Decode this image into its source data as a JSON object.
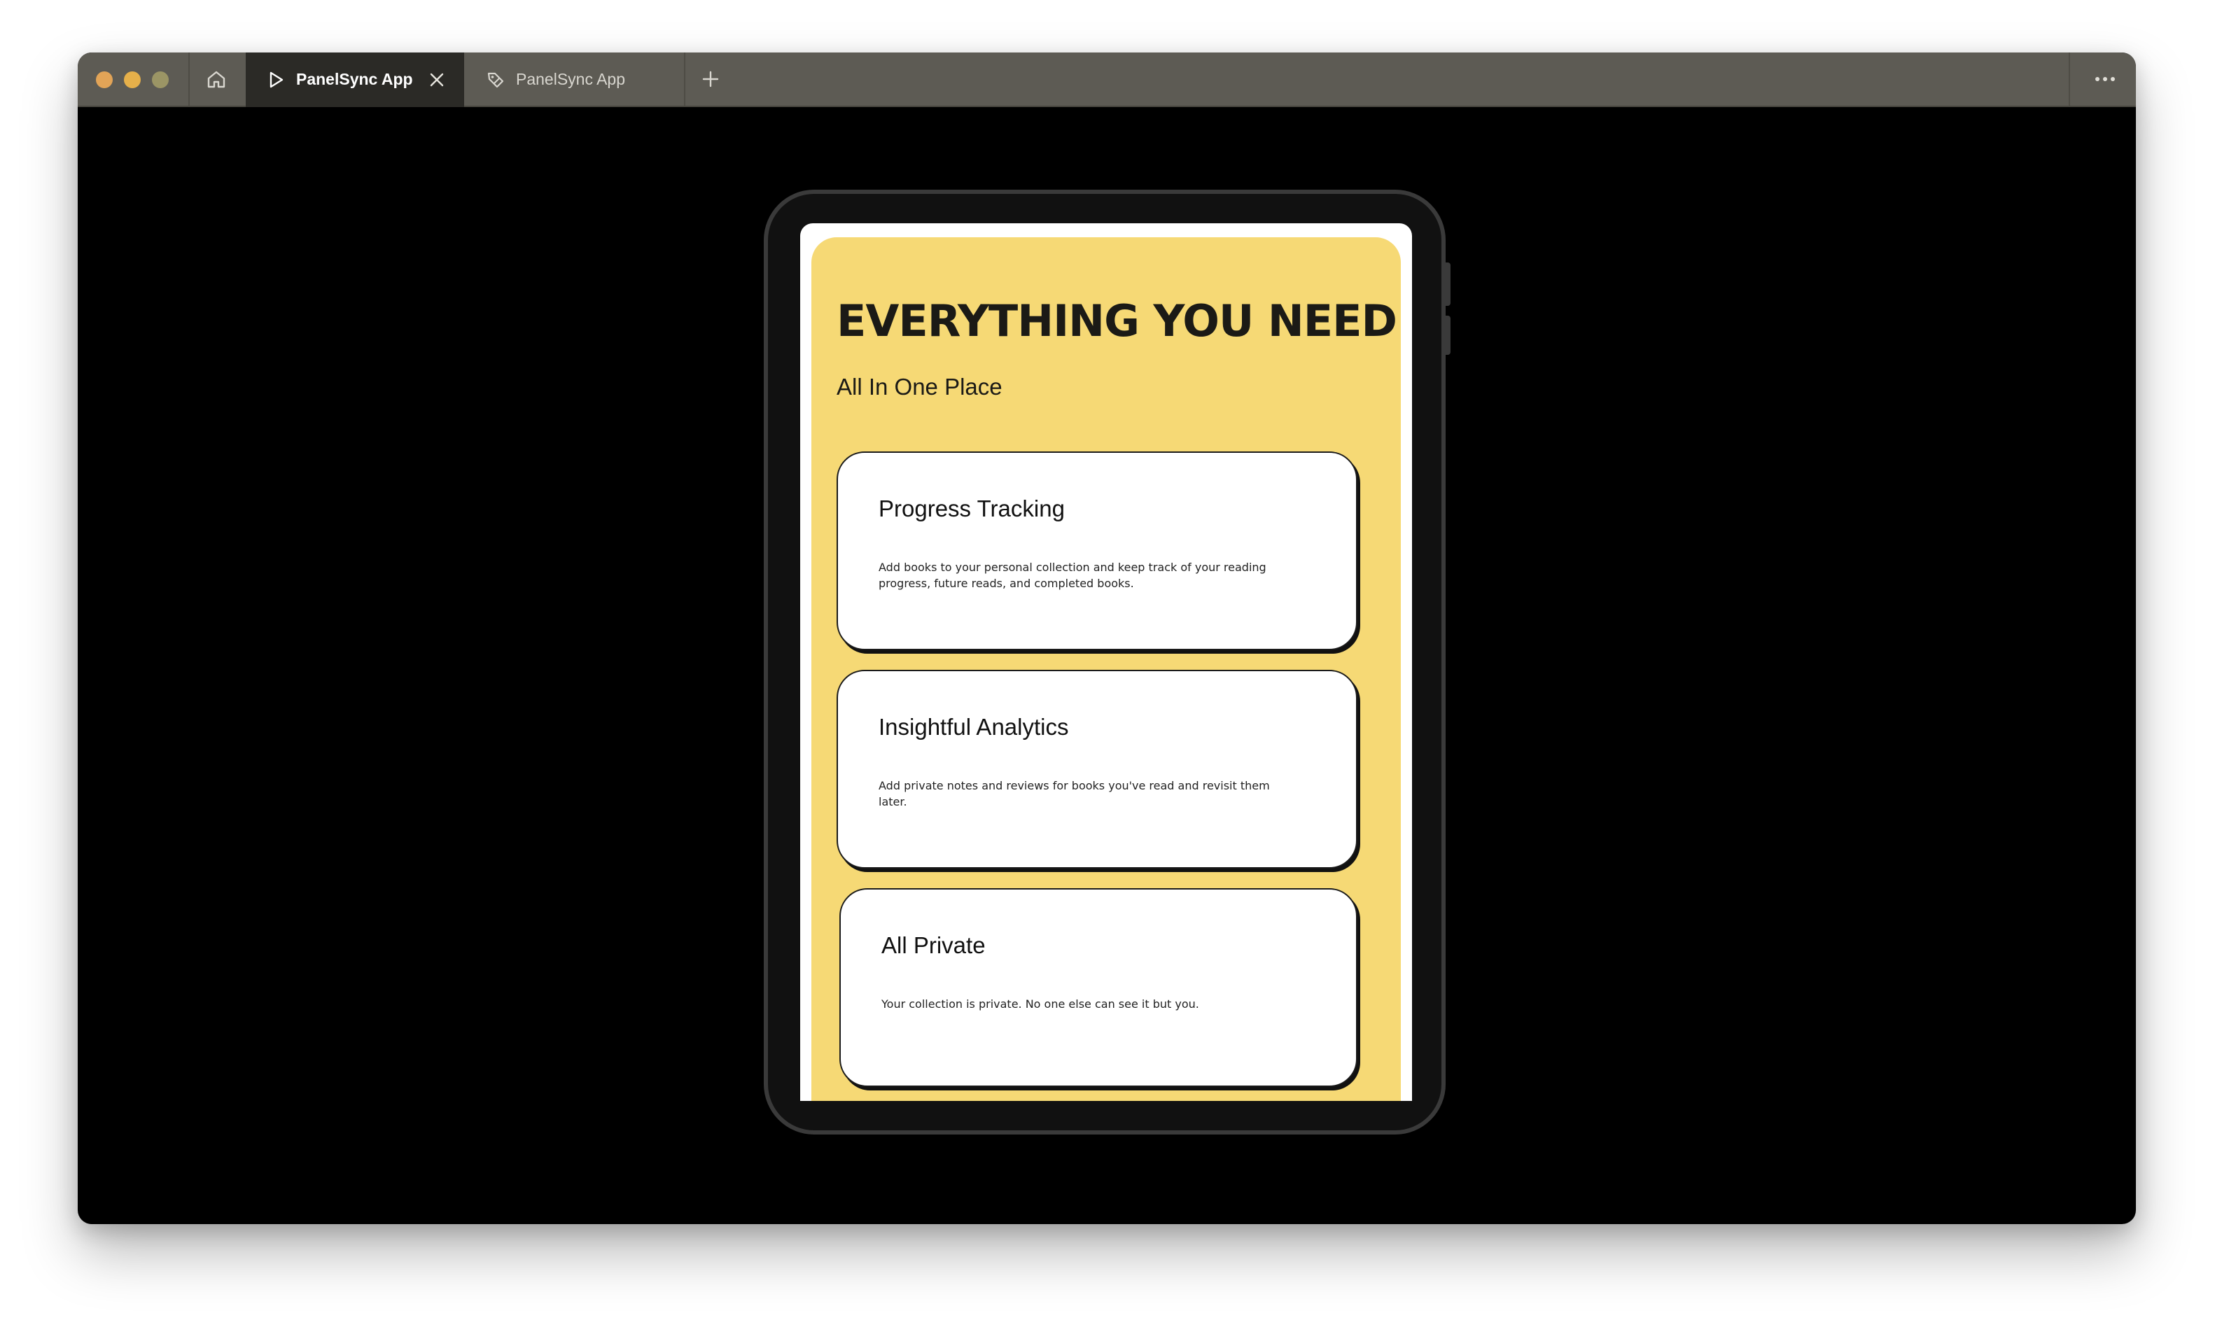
{
  "browser": {
    "tabs": [
      {
        "label": "PanelSync App",
        "active": true,
        "icon": "play-icon"
      },
      {
        "label": "PanelSync App",
        "active": false,
        "icon": "tag-icon"
      }
    ],
    "colors": {
      "titlebar": "#5d5b54",
      "active_tab": "#2b2a26"
    }
  },
  "app": {
    "headline": "EVERYTHING YOU NEED",
    "subheadline": "All In One Place",
    "colors": {
      "panel": "#f6d975",
      "card": "#ffffff",
      "text": "#1b1a16"
    },
    "features": [
      {
        "title": "Progress Tracking",
        "description": "Add books to your personal collection and keep track of your reading progress, future reads, and completed books."
      },
      {
        "title": "Insightful Analytics",
        "description": "Add private notes and reviews for books you've read and revisit them later."
      },
      {
        "title": "All Private",
        "description": "Your collection is private. No one else can see it but you."
      }
    ]
  }
}
